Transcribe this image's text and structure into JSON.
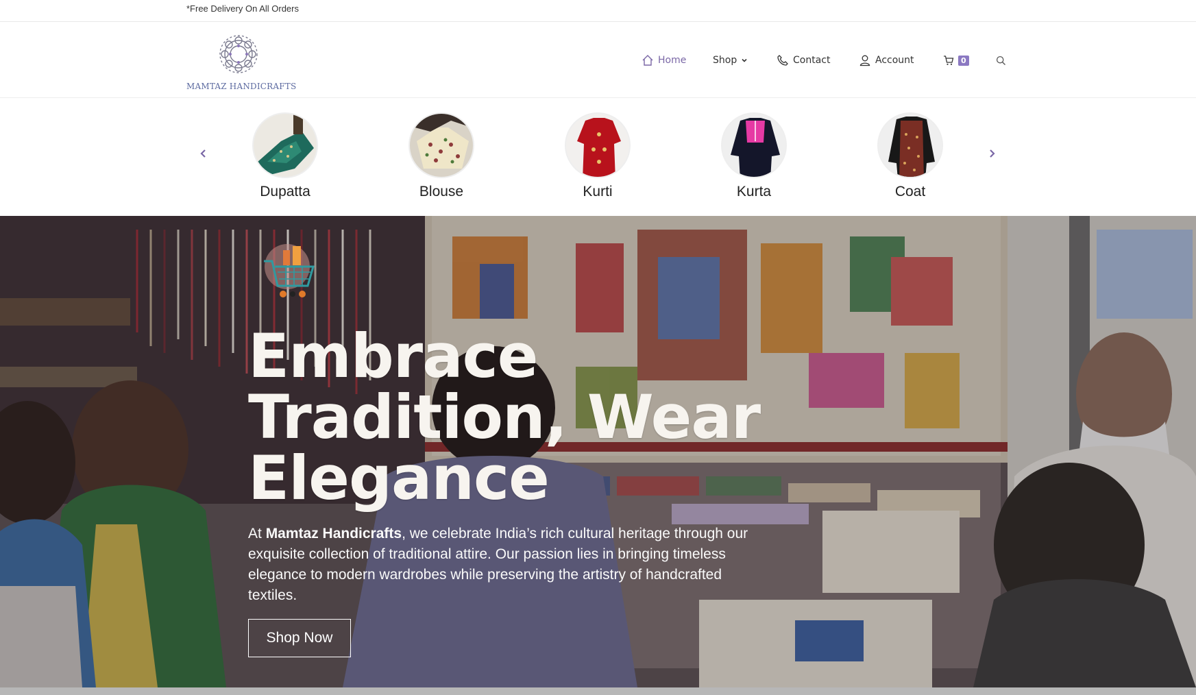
{
  "topbar": {
    "message": "*Free Delivery On All Orders"
  },
  "logo": {
    "text": "MAMTAZ HANDICRAFTS"
  },
  "nav": {
    "home": "Home",
    "shop": "Shop",
    "contact": "Contact",
    "account": "Account",
    "cart_count": "0"
  },
  "categories": [
    {
      "label": "Dupatta"
    },
    {
      "label": "Blouse"
    },
    {
      "label": "Kurti"
    },
    {
      "label": "Kurta"
    },
    {
      "label": "Coat"
    }
  ],
  "hero": {
    "title_line1": "Embrace",
    "title_line2": "Tradition, Wear",
    "title_line3": "Elegance",
    "desc_prefix": "At ",
    "desc_brand": "Mamtaz Handicrafts",
    "desc_rest": ", we celebrate India’s rich cultural heritage through our exquisite collection of traditional attire. Our passion lies in bringing timeless elegance to modern wardrobes while preserving the artistry of handcrafted textiles.",
    "button": "Shop Now"
  },
  "colors": {
    "accent": "#7a67a6",
    "badge": "#8b79c2"
  }
}
